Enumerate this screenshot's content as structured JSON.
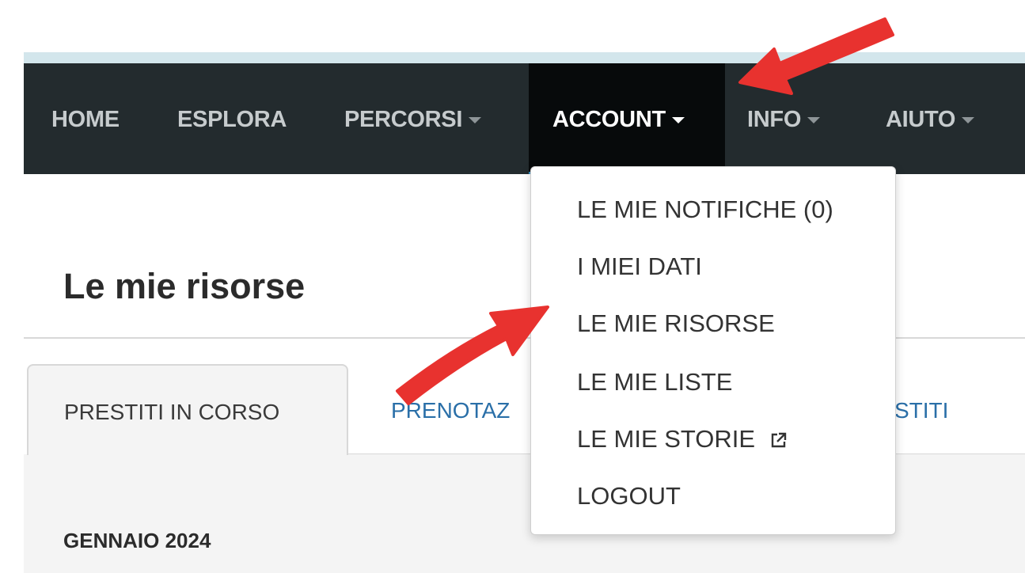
{
  "nav": {
    "home": "HOME",
    "esplora": "ESPLORA",
    "percorsi": "PERCORSI",
    "account": "ACCOUNT",
    "info": "INFO",
    "aiuto": "AIUTO"
  },
  "dropdown": {
    "items": [
      "LE MIE NOTIFICHE (0)",
      "I MIEI DATI",
      "LE MIE RISORSE",
      "LE MIE LISTE",
      "LE MIE STORIE",
      "LOGOUT"
    ]
  },
  "page": {
    "title": "Le mie risorse",
    "tabs": [
      "PRESTITI IN CORSO",
      "PRENOTAZ",
      "STITI"
    ],
    "month": "GENNAIO 2024"
  },
  "colors": {
    "navbar": "#232b2e",
    "active_nav": "#070a0b",
    "accent_link": "#2a6fa8",
    "annotation_arrow": "#e8322f"
  }
}
